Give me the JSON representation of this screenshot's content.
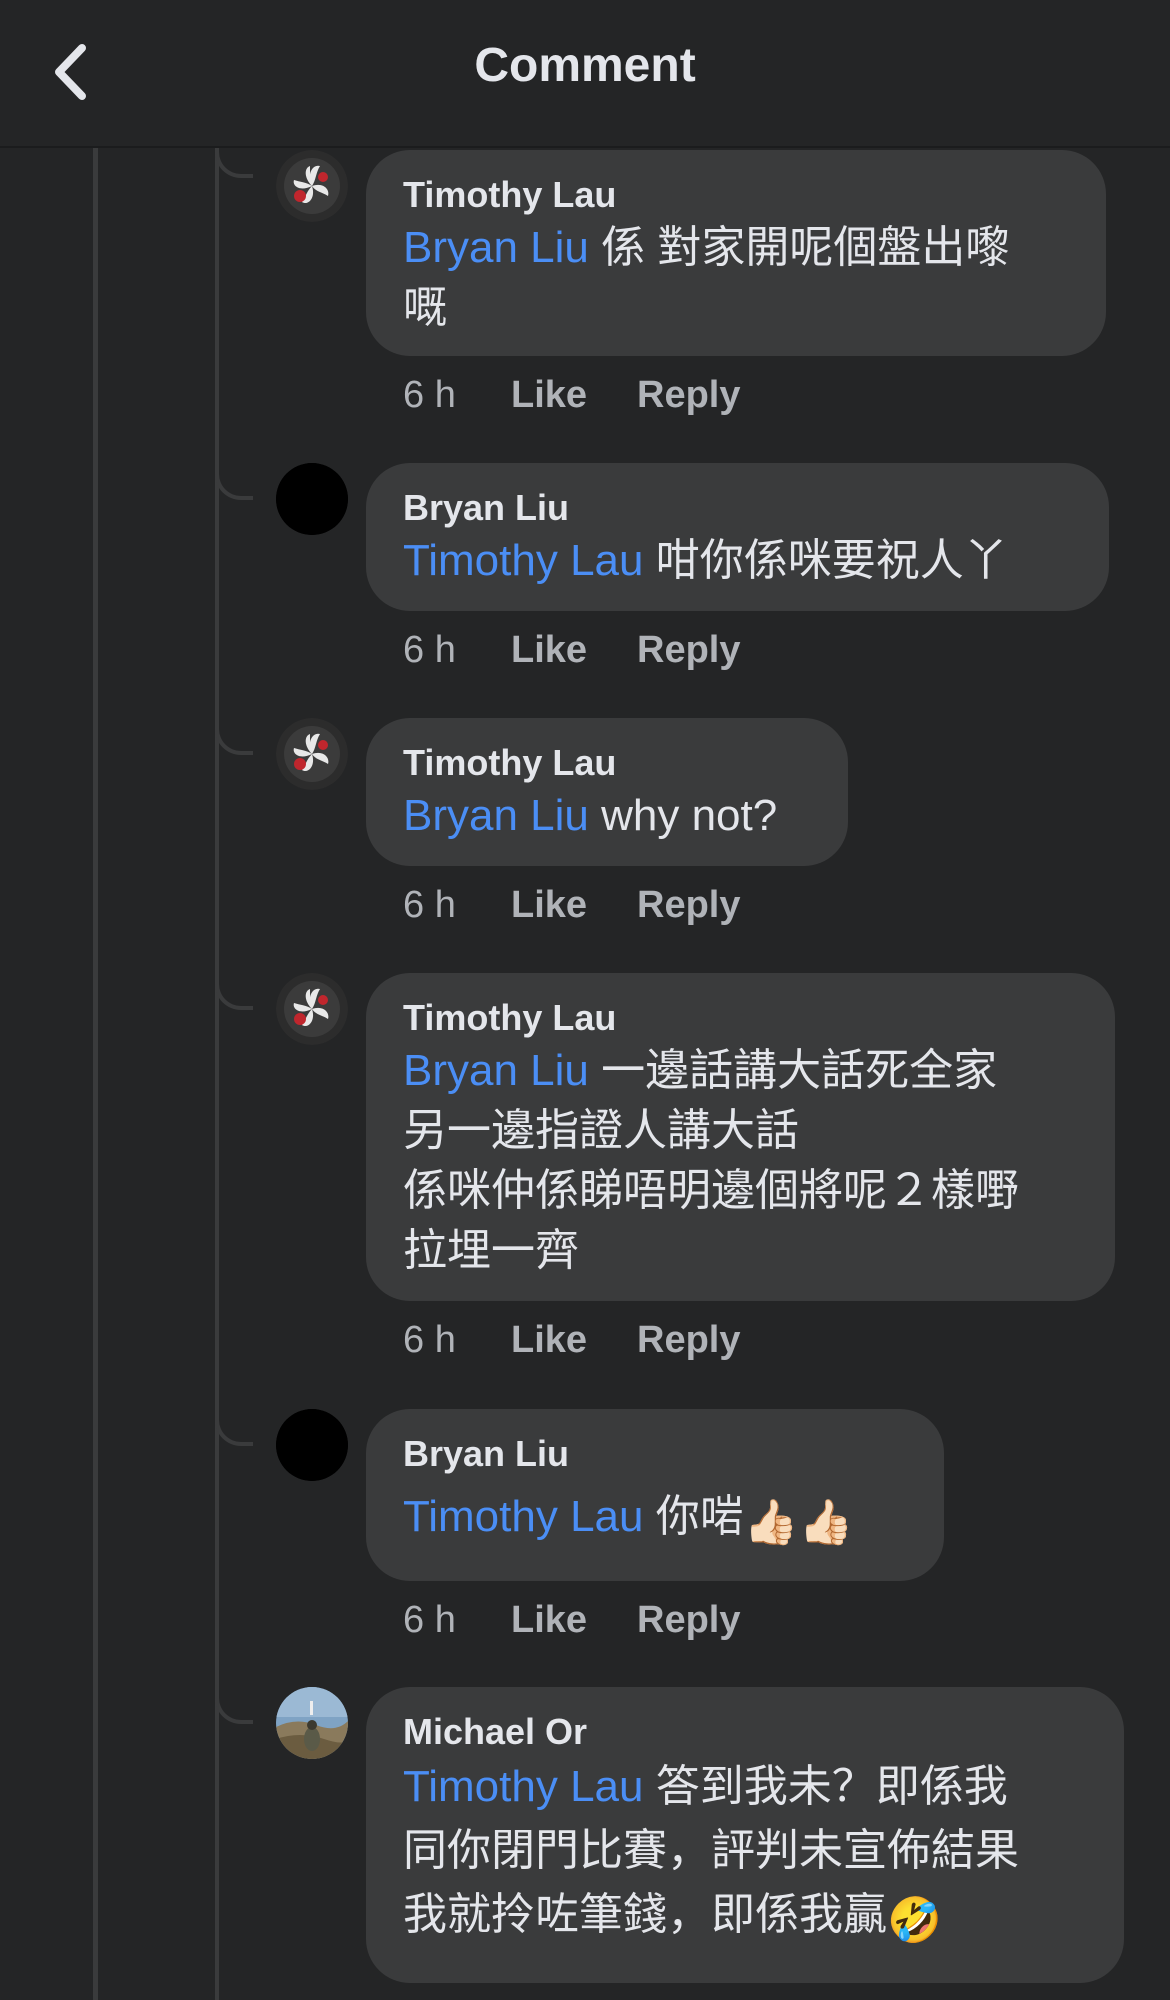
{
  "header": {
    "title": "Comment",
    "back_icon": "chevron-left-icon"
  },
  "colors": {
    "background": "#242526",
    "bubble": "#3a3b3c",
    "mention": "#4b8ef5",
    "meta": "#b0b3b8"
  },
  "comments": [
    {
      "author": "Timothy Lau",
      "mention": "Bryan Liu",
      "text": " 係 對家開呢個盤出嚟\n嘅",
      "time": "6 h",
      "like": "Like",
      "reply": "Reply",
      "avatar": "bauhinia-flag-avatar"
    },
    {
      "author": "Bryan Liu",
      "mention": "Timothy Lau",
      "text": " 咁你係咪要祝人丫",
      "time": "6 h",
      "like": "Like",
      "reply": "Reply",
      "avatar": "black-avatar"
    },
    {
      "author": "Timothy Lau",
      "mention": "Bryan Liu",
      "text": " why not?",
      "time": "6 h",
      "like": "Like",
      "reply": "Reply",
      "avatar": "bauhinia-flag-avatar"
    },
    {
      "author": "Timothy Lau",
      "mention": "Bryan Liu",
      "text": " 一邊話講大話死全家\n另一邊指證人講大話\n係咪仲係睇唔明邊個將呢２樣嘢\n拉埋一齊",
      "time": "6 h",
      "like": "Like",
      "reply": "Reply",
      "avatar": "bauhinia-flag-avatar"
    },
    {
      "author": "Bryan Liu",
      "mention": "Timothy Lau",
      "text": " 你啱",
      "emoji": "👍🏻👍🏻",
      "time": "6 h",
      "like": "Like",
      "reply": "Reply",
      "avatar": "black-avatar"
    },
    {
      "author": "Michael Or",
      "mention": "Timothy Lau",
      "text": " 答到我未？即係我\n同你閉門比賽，評判未宣佈結果\n我就拎咗筆錢，即係我贏",
      "emoji": "🤣",
      "avatar": "landscape-photo-avatar"
    }
  ]
}
